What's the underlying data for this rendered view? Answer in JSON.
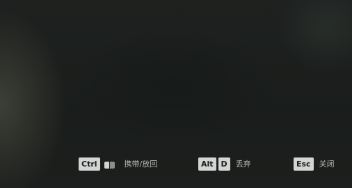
{
  "hints": {
    "carry": {
      "key": "Ctrl",
      "icon": "mouse-icon",
      "label": "携带/放回"
    },
    "discard": {
      "keys": [
        "Alt",
        "D"
      ],
      "label": "丢弃"
    },
    "close": {
      "key": "Esc",
      "label": "关闭"
    }
  },
  "colors": {
    "key_background": "#d4d4d4",
    "key_text": "#1b1b1b",
    "label_text": "#b8bbb8"
  }
}
